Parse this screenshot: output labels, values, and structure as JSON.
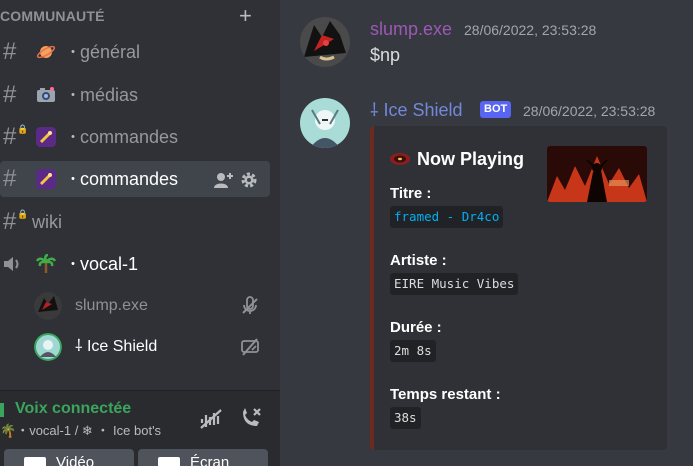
{
  "sidebar": {
    "category_label": "COMMUNAUTÉ",
    "channels": [
      {
        "name": "général",
        "dot": "・",
        "emoji": "planet-emoji",
        "locked": false,
        "active": false
      },
      {
        "name": "médias",
        "dot": "・",
        "emoji": "camera-emoji",
        "locked": false,
        "active": false
      },
      {
        "name": "commandes",
        "dot": "・",
        "emoji": "sparkles-emoji",
        "locked": true,
        "active": false
      },
      {
        "name": "commandes",
        "dot": "・",
        "emoji": "sparkles-emoji",
        "locked": false,
        "active": true
      },
      {
        "name": "wiki",
        "locked": true,
        "active": false
      }
    ],
    "voice_channel": {
      "name": "vocal-1",
      "dot": "・",
      "emoji": "palm-tree-emoji"
    },
    "voice_users": [
      {
        "name": "slump.exe",
        "icon": "deafened-icon"
      },
      {
        "name": "Ice Shield",
        "prefix": "⸸",
        "icon": "streaming-muted-icon"
      }
    ]
  },
  "voice_panel": {
    "status": "Voix connectée",
    "detail": "・vocal-1 / ❄ ・ Ice bot's",
    "buttons": [
      "Vidéo",
      "Écran"
    ]
  },
  "chat": {
    "messages": [
      {
        "author": "slump.exe",
        "author_color": "#9b59b6",
        "time": "28/06/2022, 23:53:28",
        "text": "$np"
      },
      {
        "author": "Ice Shield",
        "author_prefix": "⸸",
        "author_color": "#7289da",
        "badge": "BOT",
        "time": "28/06/2022, 23:53:28"
      }
    ],
    "embed": {
      "title": "Now Playing",
      "title_icon": "record-icon",
      "accent_color": "#6e2a1e",
      "fields": [
        {
          "name": "Titre :",
          "value": "framed - Dr4co",
          "link": true
        },
        {
          "name": "Artiste :",
          "value": "EIRE Music Vibes",
          "link": false
        },
        {
          "name": "Durée :",
          "value": "2m 8s",
          "link": false
        },
        {
          "name": "Temps restant :",
          "value": "38s",
          "link": false
        }
      ]
    }
  },
  "colors": {
    "sidebar_bg": "#2f3136",
    "chat_bg": "#36393f",
    "voice_green": "#3ba55d",
    "bot_badge": "#5865f2",
    "link_blue": "#00aff4"
  }
}
